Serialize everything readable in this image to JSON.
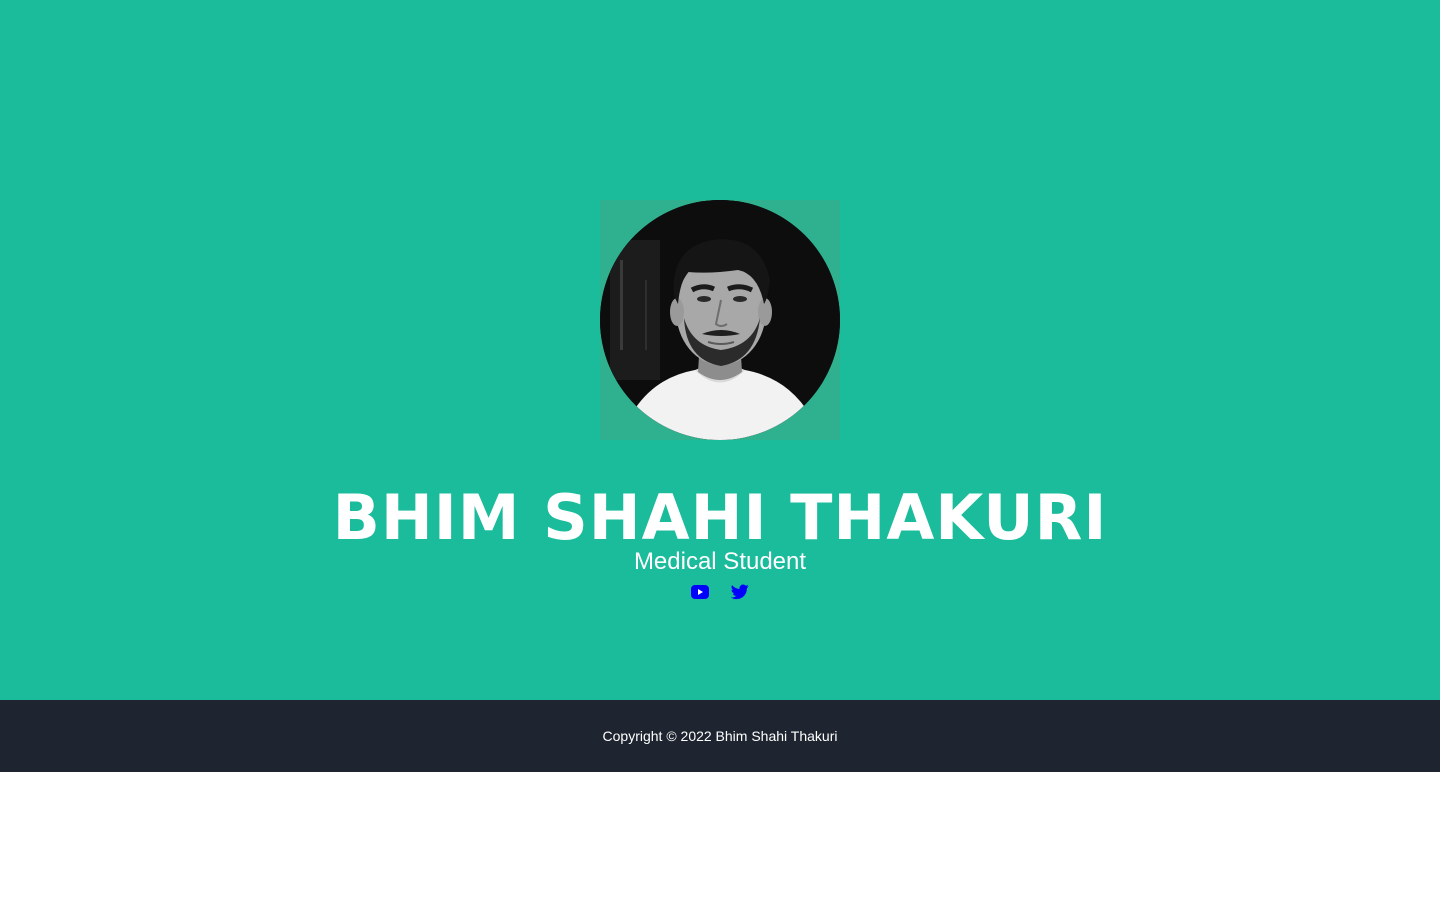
{
  "colors": {
    "hero_bg": "#1abc9c",
    "footer_bg": "#1e2530",
    "text": "#ffffff",
    "social_icon": "#0000ff"
  },
  "profile": {
    "name": "BHIM SHAHI THAKURI",
    "role": "Medical Student",
    "photo_icon": "profile-photo"
  },
  "social": [
    {
      "icon": "youtube-icon"
    },
    {
      "icon": "twitter-icon"
    }
  ],
  "footer": {
    "copyright": "Copyright © 2022 Bhim Shahi Thakuri"
  }
}
